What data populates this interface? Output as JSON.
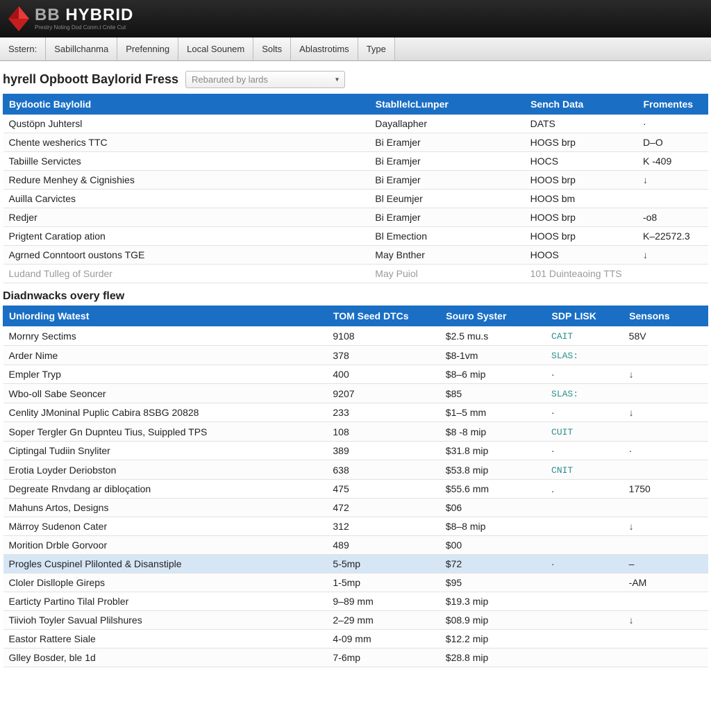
{
  "header": {
    "brand_bb": "BB",
    "brand_main": "HYBRID",
    "brand_sub": "Prestry Noting Dod Conm.t Cnite Cut"
  },
  "tabs": [
    "Sstern:",
    "Sabillchanma",
    "Prefenning",
    "Local Sounem",
    "Solts",
    "Ablastrotims",
    "Type"
  ],
  "page_title": "hyrell Opboott Baylorid Fress",
  "filter": {
    "placeholder": "Rebaruted by lards"
  },
  "table1": {
    "headers": [
      "Bydootic Baylolid",
      "StabllelcLunper",
      "Sench Data",
      "Fromentes"
    ],
    "rows": [
      {
        "c1": "Qustöpn Juhtersl",
        "c2": "Dayallapher",
        "c3": "DATS",
        "c4": "·"
      },
      {
        "c1": "Chente wesherics TTC",
        "c2": "Bi Eramjer",
        "c3": "HOGS brp",
        "c4": "D–O"
      },
      {
        "c1": "Tabiille Servictes",
        "c2": "Bi Eramjer",
        "c3": "HOCS",
        "c4": "K -409"
      },
      {
        "c1": "Redure Menhey & Cignishies",
        "c2": "Bi Eramjer",
        "c3": "HOOS brp",
        "c4": "↓"
      },
      {
        "c1": "Auilla Carvictes",
        "c2": "Bl Eeumjer",
        "c3": "HOOS bm",
        "c4": ""
      },
      {
        "c1": "Redjer",
        "c2": "Bi Eramjer",
        "c3": "HOOS brp",
        "c4": "-o8"
      },
      {
        "c1": "Prigtent Caratiop ation",
        "c2": "Bl Emection",
        "c3": "HOOS brp",
        "c4": "K–22572.3"
      },
      {
        "c1": "Agrned Conntoort oustons  TGE",
        "c2": "May Bnther",
        "c3": "HOOS",
        "c4": "↓"
      },
      {
        "c1": "Ludand Tulleg of Surder",
        "c2": "May Puiol",
        "c3": "101 Duinteaoing TTS",
        "c4": "",
        "muted": true
      }
    ]
  },
  "section2_title": "Diadnwacks overy flew",
  "table2": {
    "headers": [
      "Unlording Watest",
      "TOM Seed DTCs",
      "Souro Syster",
      "SDP LISK",
      "Sensons"
    ],
    "rows": [
      {
        "c1": "Mornry Sectims",
        "c2": "9108",
        "c3": "$2.5 mu.s",
        "c4": "CAIT",
        "c5": "58V"
      },
      {
        "c1": "Arder Nime",
        "c2": "378",
        "c3": "$8-1vm",
        "c4": "SLAS:",
        "c5": ""
      },
      {
        "c1": "Empler Tryp",
        "c2": "400",
        "c3": "$8–6 mip",
        "c4": "·",
        "c5": "↓"
      },
      {
        "c1": "Wbo-oll Sabe Seoncer",
        "c2": "9207",
        "c3": "$85",
        "c4": "SLAS:",
        "c5": ""
      },
      {
        "c1": "Cenlity JMoninal Puplic Cabira 8SBG 20828",
        "c2": "233",
        "c3": "$1–5 mm",
        "c4": "·",
        "c5": "↓"
      },
      {
        "c1": "Soper Tergler Gn Dupnteu Tius, Suippled TPS",
        "c2": "108",
        "c3": "$8 -8 mip",
        "c4": "CUIT",
        "c5": ""
      },
      {
        "c1": "Ciptingal Tudiin Snyliter",
        "c2": "389",
        "c3": "$31.8 mip",
        "c4": "·",
        "c5": "·"
      },
      {
        "c1": "Erotia Loyder Deriobston",
        "c2": "638",
        "c3": "$53.8 mip",
        "c4": "CNIT",
        "c5": ""
      },
      {
        "c1": "Degreate Rnvdang ar dibloçation",
        "c2": "475",
        "c3": "$55.6 mm",
        "c4": ".",
        "c5": "1750"
      },
      {
        "c1": "Mahuns Artos, Designs",
        "c2": "472",
        "c3": "$06",
        "c4": "",
        "c5": ""
      },
      {
        "c1": "Märroy Sudenon Cater",
        "c2": "312",
        "c3": "$8–8 mip",
        "c4": "",
        "c5": "↓"
      },
      {
        "c1": "Morition Drble Gorvoor",
        "c2": "489",
        "c3": "$00",
        "c4": "",
        "c5": ""
      },
      {
        "c1": "Progles Cuspinel Plilonted & Disanstiple",
        "c2": "5-5mp",
        "c3": "$72",
        "c4": "·",
        "c5": "–",
        "highlight": true
      },
      {
        "c1": "Cloler Disllople Gireps",
        "c2": "1-5mp",
        "c3": "$95",
        "c4": "",
        "c5": "-AM"
      },
      {
        "c1": "Earticty Partino Tilal Probler",
        "c2": "9–89 mm",
        "c3": "$19.3 mip",
        "c4": "",
        "c5": ""
      },
      {
        "c1": "Tiivioh Toyler Savual Plilshures",
        "c2": "2–29 mm",
        "c3": "$08.9 mip",
        "c4": "",
        "c5": "↓"
      },
      {
        "c1": "Eastor Rattere Siale",
        "c2": "4-09 mm",
        "c3": "$12.2 mip",
        "c4": "",
        "c5": ""
      },
      {
        "c1": "Glley Bosder, ble 1d",
        "c2": "7-6mp",
        "c3": "$28.8 mip",
        "c4": "",
        "c5": ""
      }
    ]
  }
}
